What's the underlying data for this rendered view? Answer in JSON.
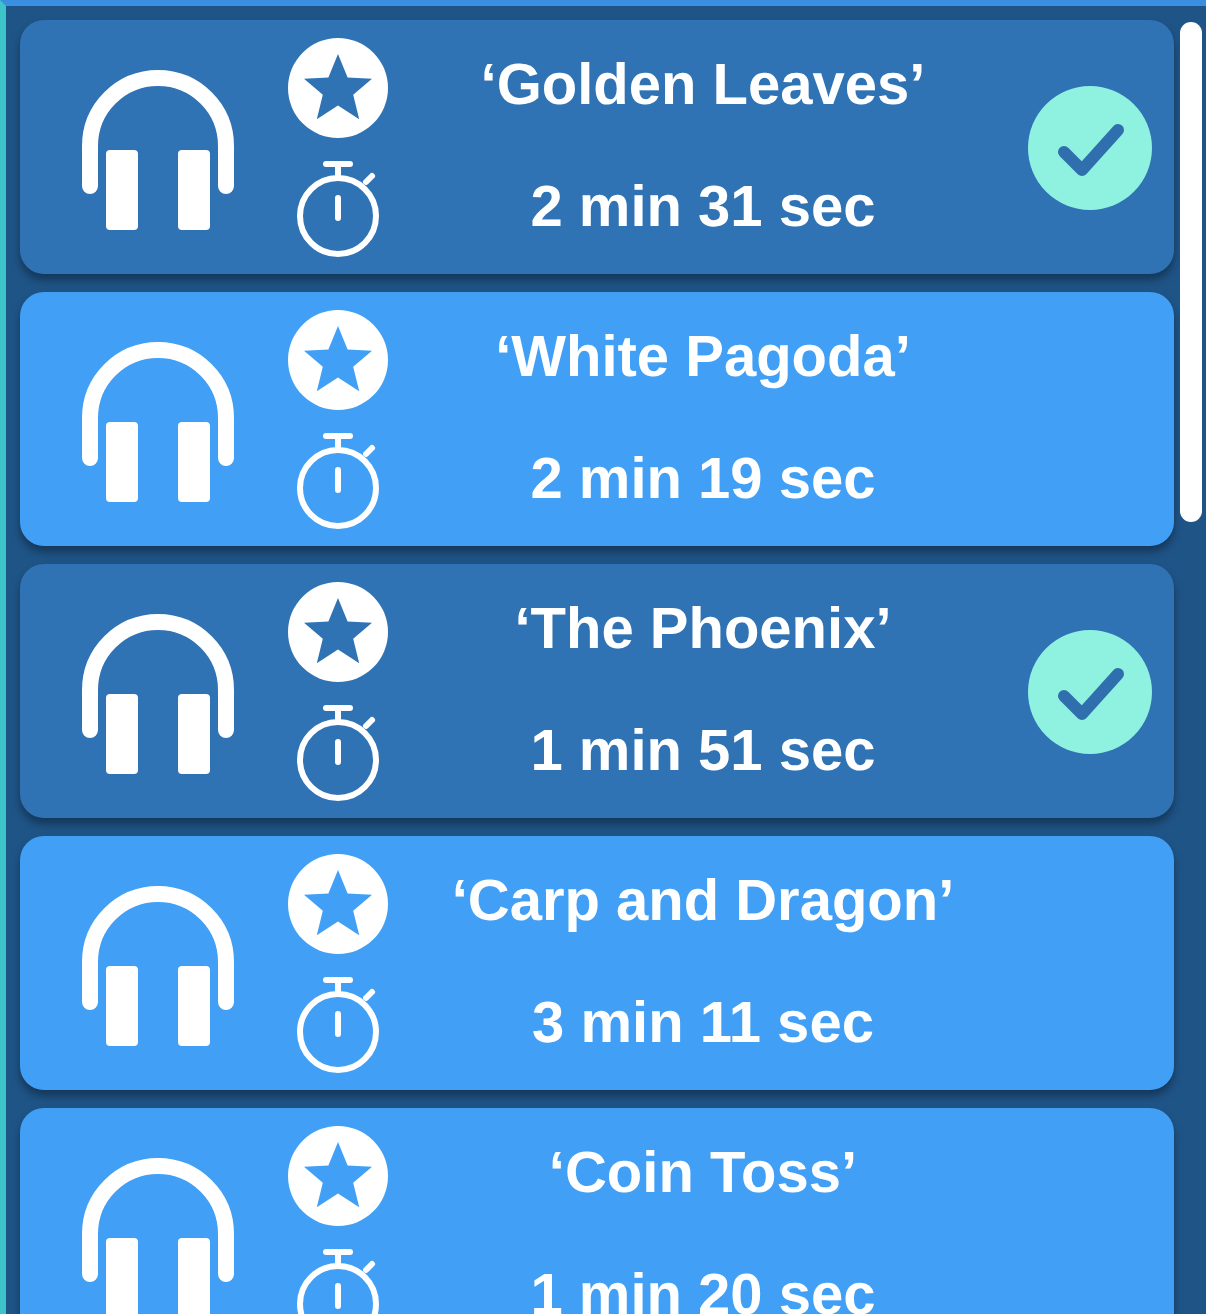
{
  "tracks": [
    {
      "title": "‘Golden Leaves’",
      "duration": "2 min 31 sec",
      "completed": true
    },
    {
      "title": "‘White Pagoda’",
      "duration": "2 min 19 sec",
      "completed": false
    },
    {
      "title": "‘The Phoenix’",
      "duration": "1 min 51 sec",
      "completed": true
    },
    {
      "title": "‘Carp and Dragon’",
      "duration": "3 min 11 sec",
      "completed": false
    },
    {
      "title": "‘Coin Toss’",
      "duration": "1 min 20 sec",
      "completed": false
    }
  ]
}
